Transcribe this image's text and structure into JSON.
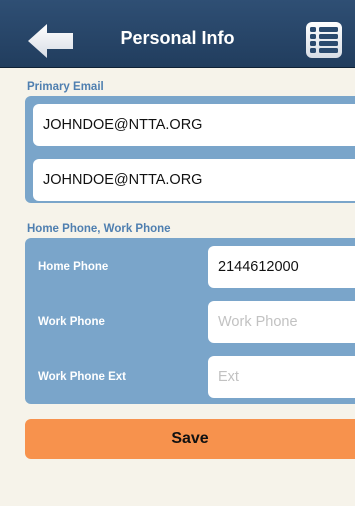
{
  "header": {
    "title": "Personal Info",
    "back_icon": "back-arrow-icon",
    "menu_icon": "list-menu-icon",
    "bar_color": "#213d5e"
  },
  "email_section": {
    "label": "Primary Email",
    "primary_email_value": "JOHNDOE@NTTA.ORG",
    "confirm_email_value": "JOHNDOE@NTTA.ORG",
    "label_color": "#4f7fb0"
  },
  "phone_section": {
    "label": "Home Phone, Work Phone",
    "home_phone": {
      "label": "Home Phone",
      "value": "2144612000",
      "placeholder": "Home Phone"
    },
    "work_phone": {
      "label": "Work Phone",
      "value": "",
      "placeholder": "Work Phone"
    },
    "work_phone_ext": {
      "label": "Work Phone Ext",
      "value": "",
      "placeholder": "Ext"
    },
    "panel_color": "#7aa5ca"
  },
  "actions": {
    "save_label": "Save",
    "save_color": "#f7924d"
  }
}
